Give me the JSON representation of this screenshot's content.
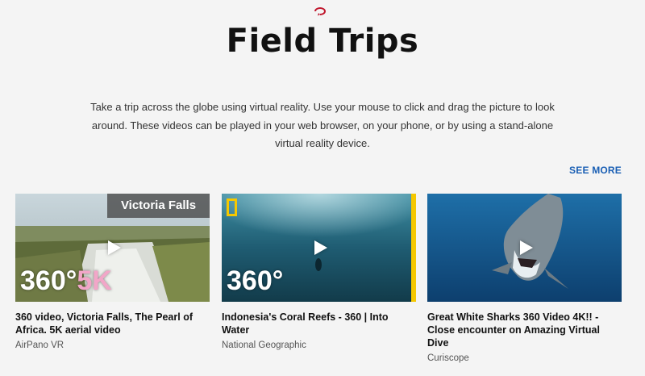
{
  "header": {
    "logo_icon": "loop-arrow-icon",
    "title": "Field Trips",
    "description": "Take a trip across the globe using virtual reality. Use your mouse to click and drag the picture to look around. These videos can be played in your web browser, on your phone, or by using a stand-alone virtual reality device."
  },
  "see_more_label": "SEE MORE",
  "colors": {
    "accent_link": "#1a5fb4",
    "background": "#f4f4f4",
    "ng_yellow": "#f5c800",
    "logo_red": "#c0172d"
  },
  "cards": [
    {
      "title": "360 video, Victoria Falls, The Pearl of Africa. 5K aerial video",
      "channel": "AirPano VR",
      "badge": "Victoria Falls",
      "overlay_360": "360°",
      "overlay_5k": "5K"
    },
    {
      "title": "Indonesia's Coral Reefs - 360 | Into Water",
      "channel": "National Geographic",
      "overlay_360": "360°"
    },
    {
      "title": "Great White Sharks 360 Video 4K!! - Close encounter on Amazing Virtual Dive",
      "channel": "Curiscope"
    }
  ]
}
